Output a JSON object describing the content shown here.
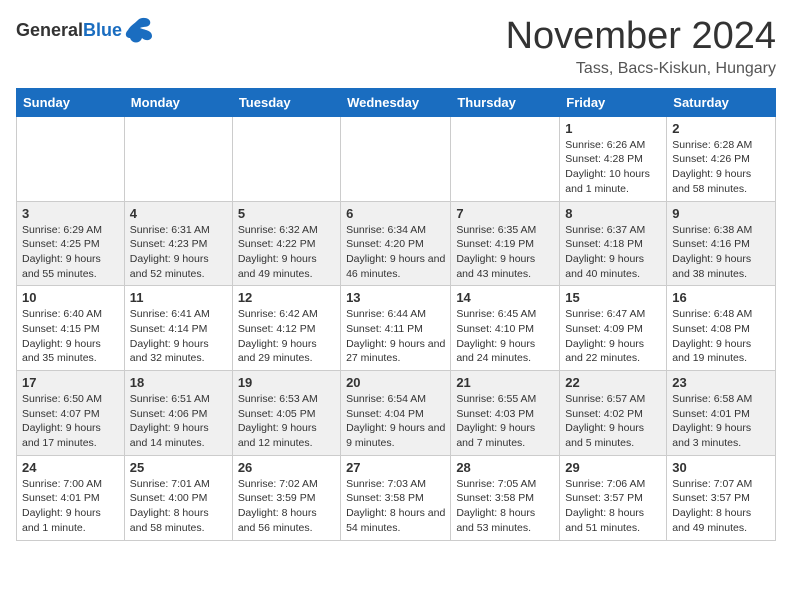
{
  "header": {
    "logo_general": "General",
    "logo_blue": "Blue",
    "month_title": "November 2024",
    "location": "Tass, Bacs-Kiskun, Hungary"
  },
  "weekdays": [
    "Sunday",
    "Monday",
    "Tuesday",
    "Wednesday",
    "Thursday",
    "Friday",
    "Saturday"
  ],
  "weeks": [
    [
      {
        "day": "",
        "info": ""
      },
      {
        "day": "",
        "info": ""
      },
      {
        "day": "",
        "info": ""
      },
      {
        "day": "",
        "info": ""
      },
      {
        "day": "",
        "info": ""
      },
      {
        "day": "1",
        "info": "Sunrise: 6:26 AM\nSunset: 4:28 PM\nDaylight: 10 hours and 1 minute."
      },
      {
        "day": "2",
        "info": "Sunrise: 6:28 AM\nSunset: 4:26 PM\nDaylight: 9 hours and 58 minutes."
      }
    ],
    [
      {
        "day": "3",
        "info": "Sunrise: 6:29 AM\nSunset: 4:25 PM\nDaylight: 9 hours and 55 minutes."
      },
      {
        "day": "4",
        "info": "Sunrise: 6:31 AM\nSunset: 4:23 PM\nDaylight: 9 hours and 52 minutes."
      },
      {
        "day": "5",
        "info": "Sunrise: 6:32 AM\nSunset: 4:22 PM\nDaylight: 9 hours and 49 minutes."
      },
      {
        "day": "6",
        "info": "Sunrise: 6:34 AM\nSunset: 4:20 PM\nDaylight: 9 hours and 46 minutes."
      },
      {
        "day": "7",
        "info": "Sunrise: 6:35 AM\nSunset: 4:19 PM\nDaylight: 9 hours and 43 minutes."
      },
      {
        "day": "8",
        "info": "Sunrise: 6:37 AM\nSunset: 4:18 PM\nDaylight: 9 hours and 40 minutes."
      },
      {
        "day": "9",
        "info": "Sunrise: 6:38 AM\nSunset: 4:16 PM\nDaylight: 9 hours and 38 minutes."
      }
    ],
    [
      {
        "day": "10",
        "info": "Sunrise: 6:40 AM\nSunset: 4:15 PM\nDaylight: 9 hours and 35 minutes."
      },
      {
        "day": "11",
        "info": "Sunrise: 6:41 AM\nSunset: 4:14 PM\nDaylight: 9 hours and 32 minutes."
      },
      {
        "day": "12",
        "info": "Sunrise: 6:42 AM\nSunset: 4:12 PM\nDaylight: 9 hours and 29 minutes."
      },
      {
        "day": "13",
        "info": "Sunrise: 6:44 AM\nSunset: 4:11 PM\nDaylight: 9 hours and 27 minutes."
      },
      {
        "day": "14",
        "info": "Sunrise: 6:45 AM\nSunset: 4:10 PM\nDaylight: 9 hours and 24 minutes."
      },
      {
        "day": "15",
        "info": "Sunrise: 6:47 AM\nSunset: 4:09 PM\nDaylight: 9 hours and 22 minutes."
      },
      {
        "day": "16",
        "info": "Sunrise: 6:48 AM\nSunset: 4:08 PM\nDaylight: 9 hours and 19 minutes."
      }
    ],
    [
      {
        "day": "17",
        "info": "Sunrise: 6:50 AM\nSunset: 4:07 PM\nDaylight: 9 hours and 17 minutes."
      },
      {
        "day": "18",
        "info": "Sunrise: 6:51 AM\nSunset: 4:06 PM\nDaylight: 9 hours and 14 minutes."
      },
      {
        "day": "19",
        "info": "Sunrise: 6:53 AM\nSunset: 4:05 PM\nDaylight: 9 hours and 12 minutes."
      },
      {
        "day": "20",
        "info": "Sunrise: 6:54 AM\nSunset: 4:04 PM\nDaylight: 9 hours and 9 minutes."
      },
      {
        "day": "21",
        "info": "Sunrise: 6:55 AM\nSunset: 4:03 PM\nDaylight: 9 hours and 7 minutes."
      },
      {
        "day": "22",
        "info": "Sunrise: 6:57 AM\nSunset: 4:02 PM\nDaylight: 9 hours and 5 minutes."
      },
      {
        "day": "23",
        "info": "Sunrise: 6:58 AM\nSunset: 4:01 PM\nDaylight: 9 hours and 3 minutes."
      }
    ],
    [
      {
        "day": "24",
        "info": "Sunrise: 7:00 AM\nSunset: 4:01 PM\nDaylight: 9 hours and 1 minute."
      },
      {
        "day": "25",
        "info": "Sunrise: 7:01 AM\nSunset: 4:00 PM\nDaylight: 8 hours and 58 minutes."
      },
      {
        "day": "26",
        "info": "Sunrise: 7:02 AM\nSunset: 3:59 PM\nDaylight: 8 hours and 56 minutes."
      },
      {
        "day": "27",
        "info": "Sunrise: 7:03 AM\nSunset: 3:58 PM\nDaylight: 8 hours and 54 minutes."
      },
      {
        "day": "28",
        "info": "Sunrise: 7:05 AM\nSunset: 3:58 PM\nDaylight: 8 hours and 53 minutes."
      },
      {
        "day": "29",
        "info": "Sunrise: 7:06 AM\nSunset: 3:57 PM\nDaylight: 8 hours and 51 minutes."
      },
      {
        "day": "30",
        "info": "Sunrise: 7:07 AM\nSunset: 3:57 PM\nDaylight: 8 hours and 49 minutes."
      }
    ]
  ]
}
